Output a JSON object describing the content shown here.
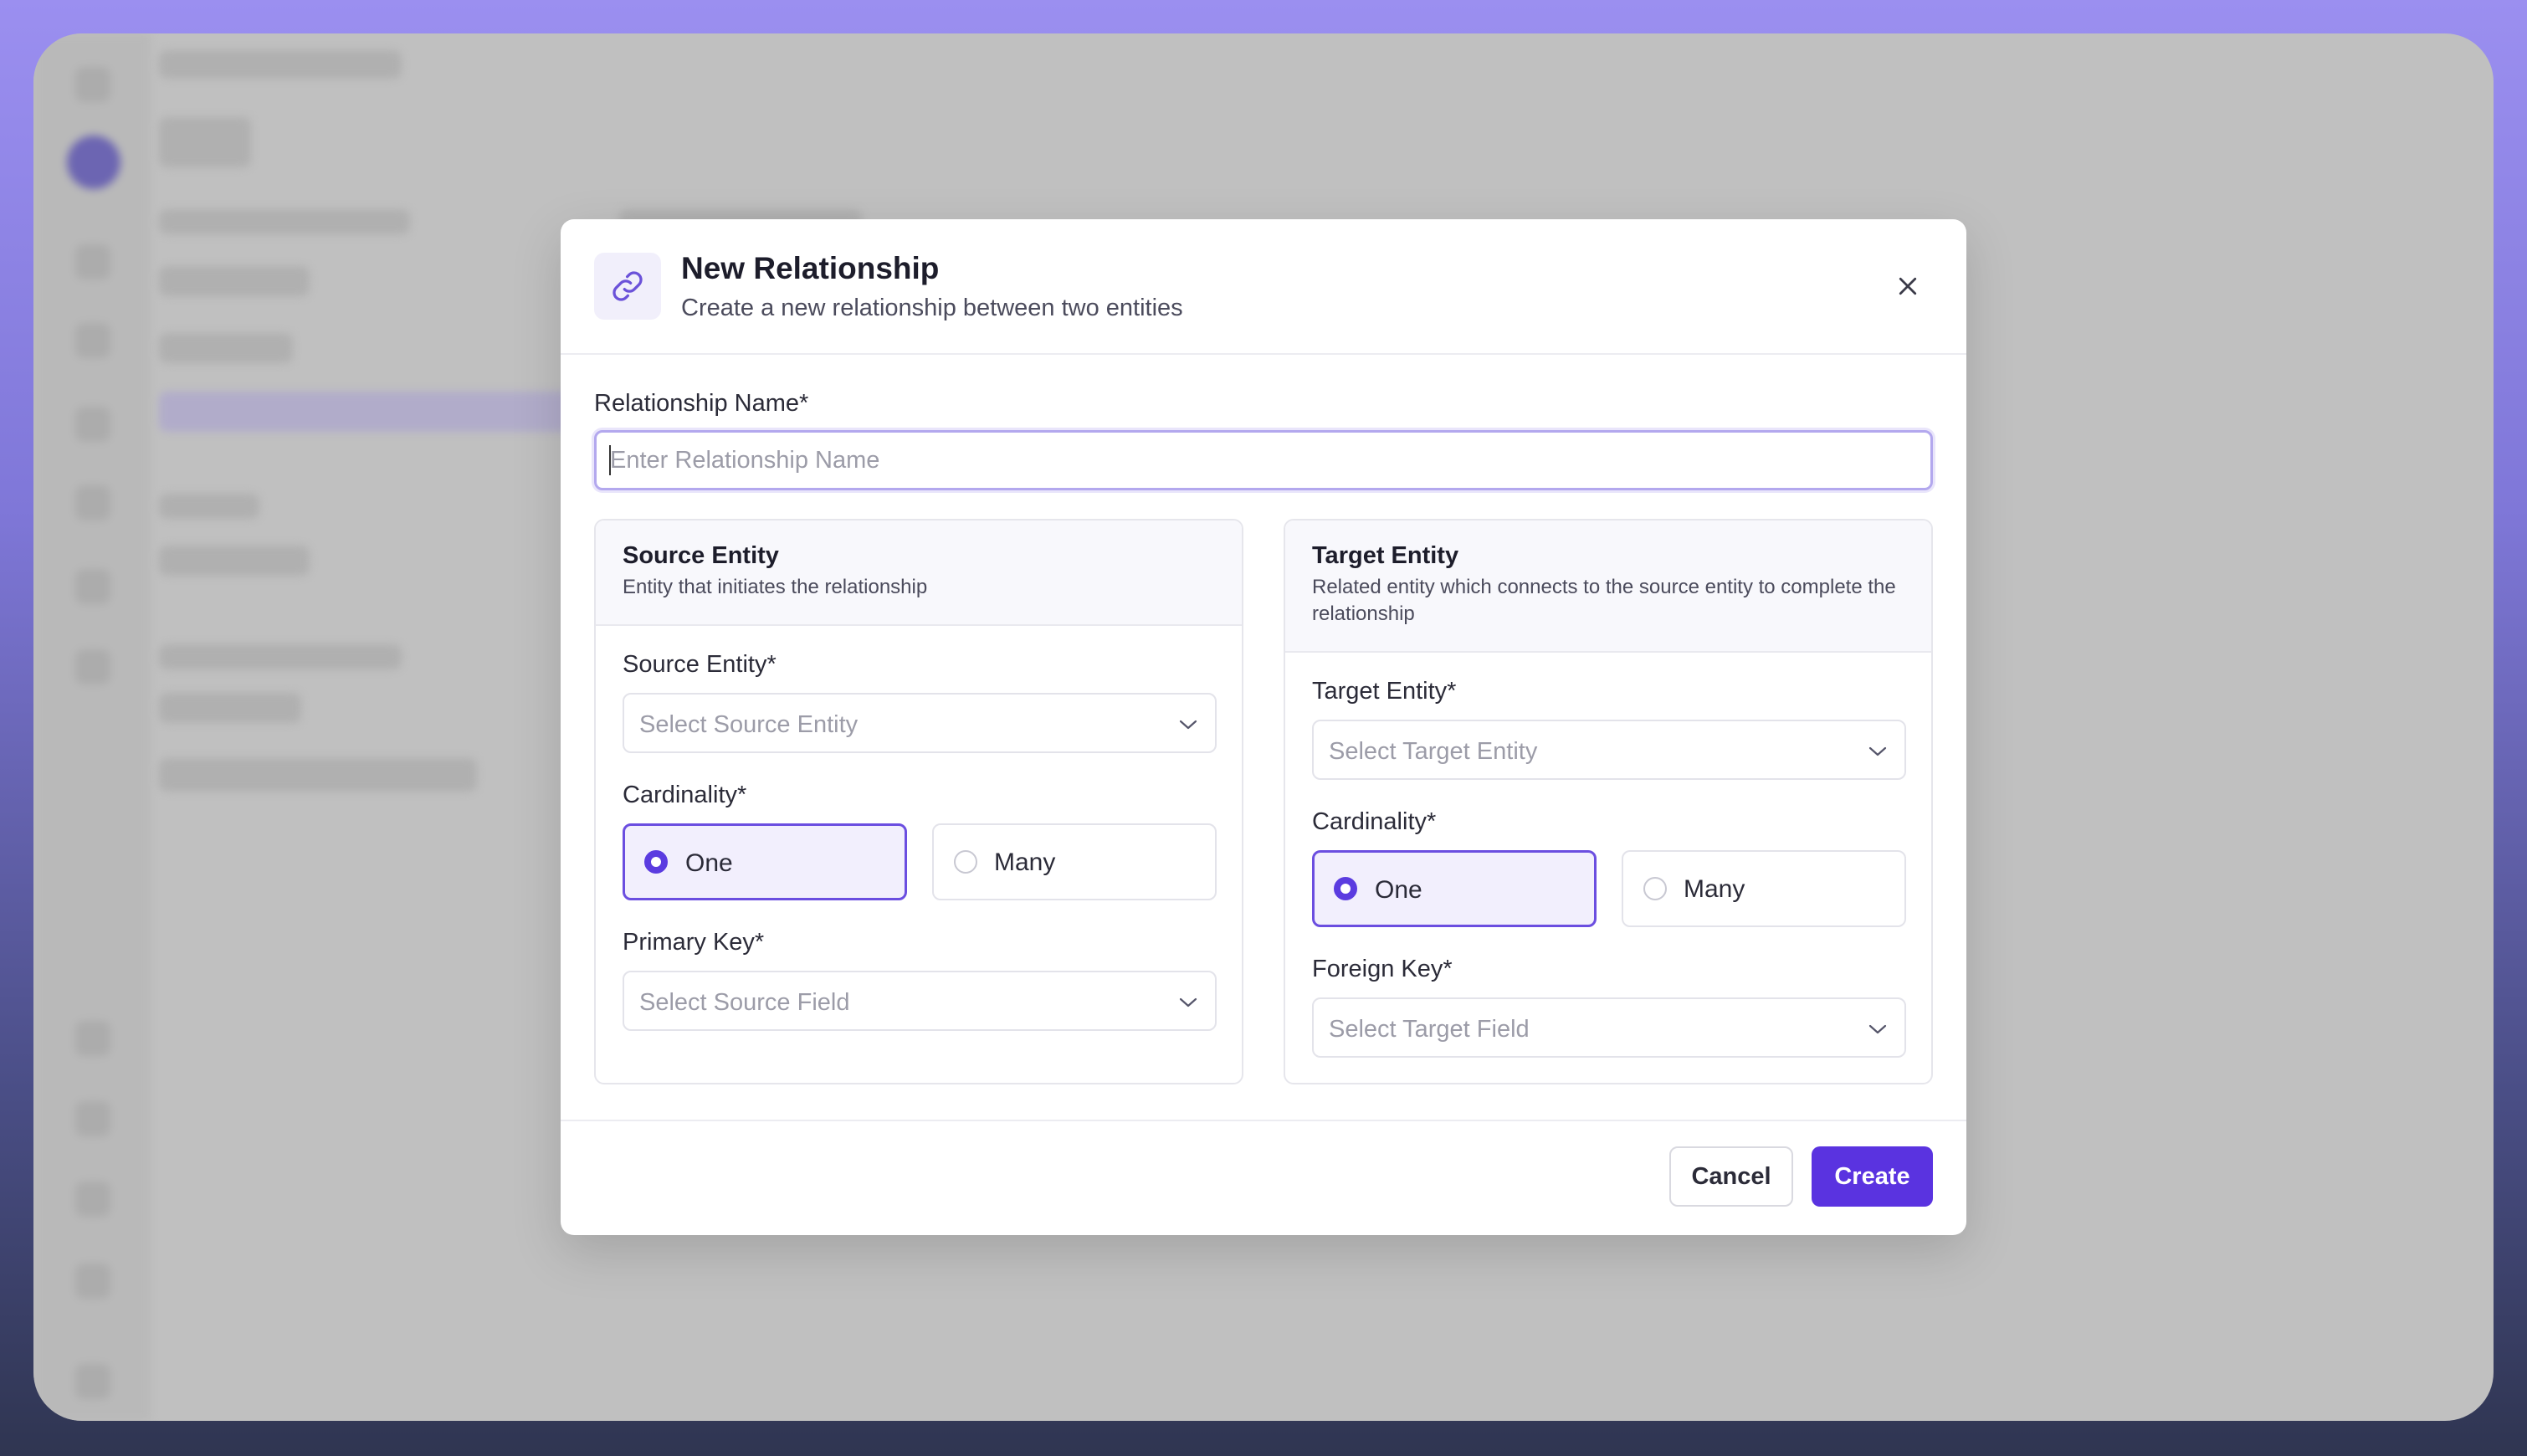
{
  "dialog": {
    "title": "New Relationship",
    "subtitle": "Create a new relationship between two entities",
    "icon": "link-icon",
    "close_icon": "close-icon"
  },
  "name_field": {
    "label": "Relationship Name*",
    "placeholder": "Enter Relationship Name",
    "value": ""
  },
  "source": {
    "title": "Source Entity",
    "description": "Entity that initiates the relationship",
    "entity_label": "Source Entity*",
    "entity_placeholder": "Select Source Entity",
    "cardinality_label": "Cardinality*",
    "options": [
      "One",
      "Many"
    ],
    "selected": "One",
    "key_label": "Primary Key*",
    "key_placeholder": "Select Source Field"
  },
  "target": {
    "title": "Target Entity",
    "description": "Related entity which connects to the source entity to complete the relationship",
    "entity_label": "Target Entity*",
    "entity_placeholder": "Select Target Entity",
    "cardinality_label": "Cardinality*",
    "options": [
      "One",
      "Many"
    ],
    "selected": "One",
    "key_label": "Foreign Key*",
    "key_placeholder": "Select Target Field"
  },
  "footer": {
    "cancel_label": "Cancel",
    "create_label": "Create"
  },
  "colors": {
    "accent": "#5a33e0",
    "selected_bg": "#f2effd",
    "frame_top": "#9b8ff0",
    "frame_bottom": "#2f3551"
  }
}
